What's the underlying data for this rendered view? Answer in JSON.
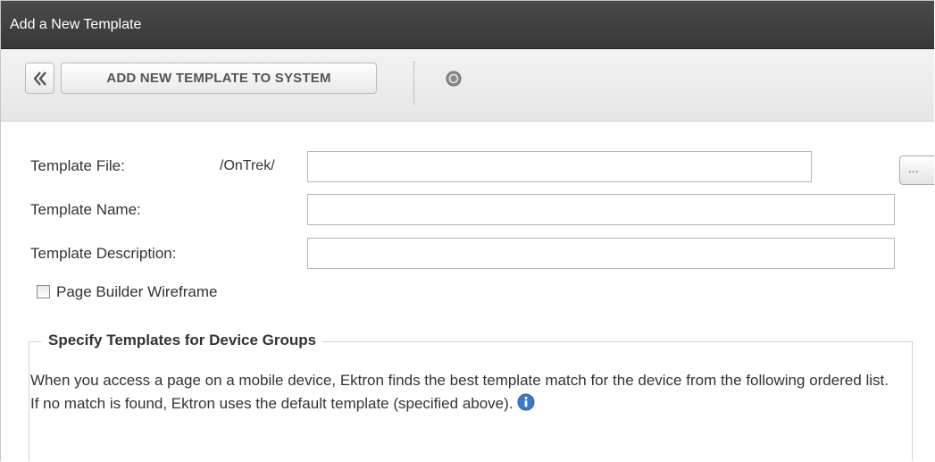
{
  "window": {
    "title": "Add a New Template"
  },
  "toolbar": {
    "add_label": "ADD NEW TEMPLATE TO SYSTEM"
  },
  "form": {
    "template_file_label": "Template File:",
    "template_file_prefix": "/OnTrek/",
    "template_file_value": "",
    "browse_label": "...",
    "template_name_label": "Template Name:",
    "template_name_value": "",
    "template_description_label": "Template Description:",
    "template_description_value": "",
    "page_builder_label": "Page Builder Wireframe",
    "page_builder_checked": false
  },
  "device_groups": {
    "legend": "Specify Templates for Device Groups",
    "description": "When you access a page on a mobile device, Ektron finds the best template match for the device from the following ordered list. If no match is found, Ektron uses the default template (specified above)."
  },
  "icons": {
    "back": "chevron-left-icon",
    "help": "help-icon",
    "info": "info-icon"
  },
  "colors": {
    "titlebar": "#3c3c3c",
    "info_blue": "#3a79c9"
  }
}
